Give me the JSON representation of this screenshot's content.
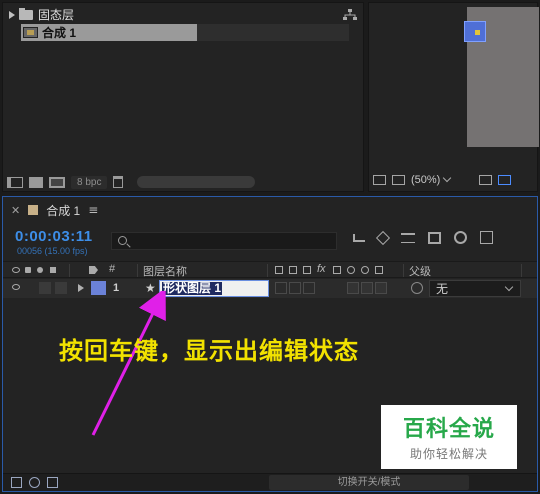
{
  "project": {
    "folder_label": "固态层",
    "comp_label": "合成 1",
    "bpc_label": "8 bpc"
  },
  "viewer": {
    "zoom_label": "(50%)"
  },
  "timeline": {
    "tab_label": "合成 1",
    "timecode": "0:00:03:11",
    "frames_label": "00056 (15.00 fps)",
    "columns": {
      "num": "#",
      "layer_name": "图层名称",
      "parent": "父级"
    },
    "layer": {
      "number": "1",
      "name": "形状图层 1",
      "parent_value": "无"
    },
    "footer_toggle": "切换开关/模式"
  },
  "annotation": {
    "text": "按回车键，显示出编辑状态",
    "arrow_color": "#e020e8",
    "text_color": "#f2e200"
  },
  "watermark": {
    "title": "百科全说",
    "subtitle": "助你轻松解决"
  },
  "icons": [
    "triangle-right-icon",
    "folder-icon",
    "composition-icon",
    "network-icon",
    "search-icon",
    "eye-icon",
    "lock-icon",
    "tag-icon",
    "star-icon",
    "trash-icon",
    "chevron-down-icon"
  ]
}
